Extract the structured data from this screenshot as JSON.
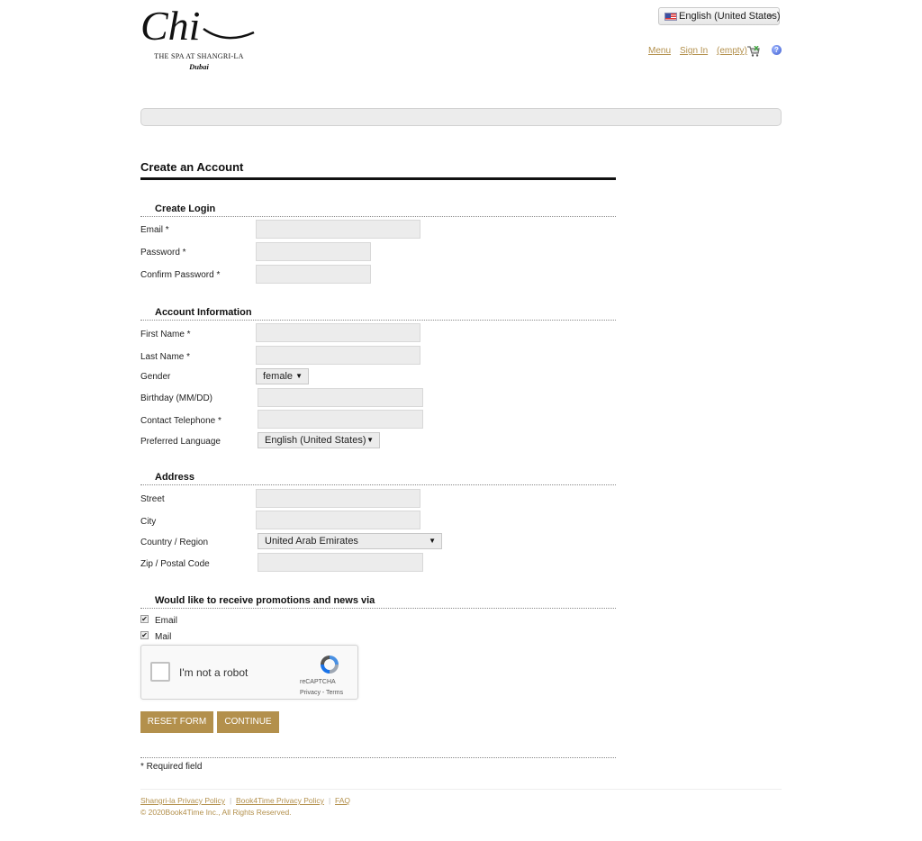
{
  "brand": {
    "logo_text": "Chi",
    "tagline": "THE SPA AT SHANGRI-LA",
    "location": "Dubai"
  },
  "header": {
    "language": "English (United States)",
    "links": {
      "menu": "Menu",
      "sign_in": "Sign In",
      "cart": "(empty)"
    },
    "help_glyph": "?",
    "icons": {
      "flag": "us-flag-icon",
      "cart": "cart-icon",
      "help": "help-icon"
    }
  },
  "page": {
    "title": "Create an Account"
  },
  "sections": {
    "login": "Create Login",
    "account": "Account Information",
    "address": "Address",
    "promotions": "Would like to receive promotions and news via"
  },
  "fields": {
    "email": {
      "label": "Email *",
      "value": ""
    },
    "password": {
      "label": "Password *",
      "value": ""
    },
    "confirm_password": {
      "label": "Confirm Password *",
      "value": ""
    },
    "first_name": {
      "label": "First Name *",
      "value": ""
    },
    "last_name": {
      "label": "Last Name *",
      "value": ""
    },
    "gender": {
      "label": "Gender",
      "value": "female"
    },
    "birthday": {
      "label": "Birthday (MM/DD)",
      "value": ""
    },
    "telephone": {
      "label": "Contact Telephone *",
      "value": ""
    },
    "language": {
      "label": "Preferred Language",
      "value": "English (United States)"
    },
    "street": {
      "label": "Street",
      "value": ""
    },
    "city": {
      "label": "City",
      "value": ""
    },
    "country": {
      "label": "Country / Region",
      "value": "United Arab Emirates"
    },
    "zip": {
      "label": "Zip / Postal Code",
      "value": ""
    }
  },
  "promotions": {
    "email": {
      "label": "Email",
      "checked": true
    },
    "mail": {
      "label": "Mail",
      "checked": true
    }
  },
  "captcha": {
    "label": "I'm not a robot",
    "brand": "reCAPTCHA",
    "terms": "Privacy - Terms"
  },
  "buttons": {
    "reset": "RESET FORM",
    "continue": "CONTINUE"
  },
  "required_note": "* Required field",
  "footer": {
    "links": [
      "Shangri-la Privacy Policy",
      "Book4Time Privacy Policy",
      "FAQ"
    ],
    "separator": "|",
    "copyright": "© 2020Book4Time Inc., All Rights Reserved."
  },
  "colors": {
    "accent": "#b3904c",
    "field_bg": "#ececec",
    "text": "#222222"
  }
}
